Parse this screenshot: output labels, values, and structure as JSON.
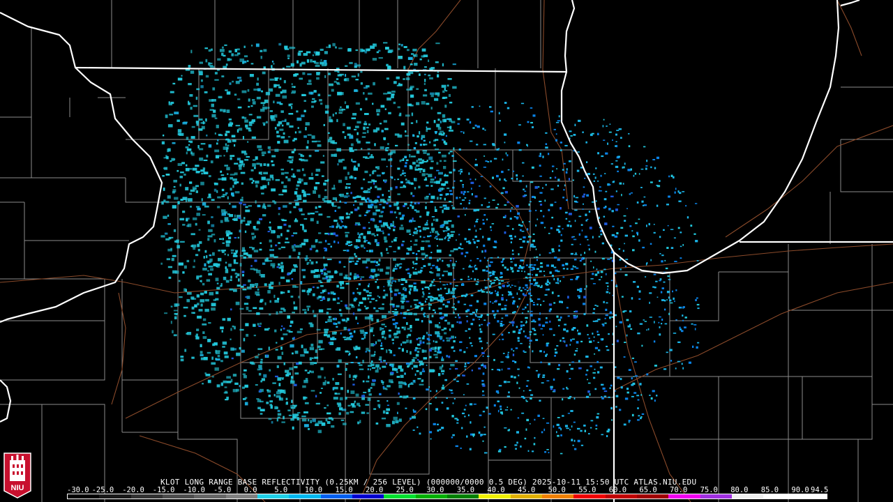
{
  "caption": {
    "text": "KLOT LONG RANGE BASE REFLECTIVITY (0.25KM / 256 LEVEL) (000000/0000 0.5 DEG) 2025-10-11 15:50 UTC  ATLAS.NIU.EDU"
  },
  "logo": {
    "text": "NIU",
    "bg_color": "#c8102e",
    "icon": "niu-tower-icon"
  },
  "colorbar": {
    "labels": [
      "-30.0",
      "-25.0",
      "-20.0",
      "-15.0",
      "-10.0",
      "-5.0",
      "0.0",
      "5.0",
      "10.0",
      "15.0",
      "20.0",
      "25.0",
      "30.0",
      "35.0",
      "40.0",
      "45.0",
      "50.0",
      "55.0",
      "60.0",
      "65.0",
      "70.0",
      "75.0",
      "80.0",
      "85.0",
      "90.0",
      "94.5"
    ],
    "colors": [
      "#000000",
      "#1a1a1a",
      "#333333",
      "#4d4d4d",
      "#666666",
      "#808080",
      "#20d0e8",
      "#00b8f0",
      "#0060f0",
      "#0000d0",
      "#00e030",
      "#00b000",
      "#008000",
      "#f0f000",
      "#e0b000",
      "#f08000",
      "#f00000",
      "#c00000",
      "#a00000",
      "#f000f0",
      "#a030e0",
      "#f0f0f0",
      "#ffffff",
      "#ffffff"
    ]
  },
  "map": {
    "background": "#000000",
    "state_border_color": "#ffffff",
    "county_border_color": "#8c8c8c",
    "highway_color": "#8a4a2a",
    "echo_colors": [
      "#22c8dc",
      "#1ab4e6",
      "#28d2e0",
      "#0a82e6",
      "#1e5adc"
    ],
    "radar_site": "KLOT"
  }
}
